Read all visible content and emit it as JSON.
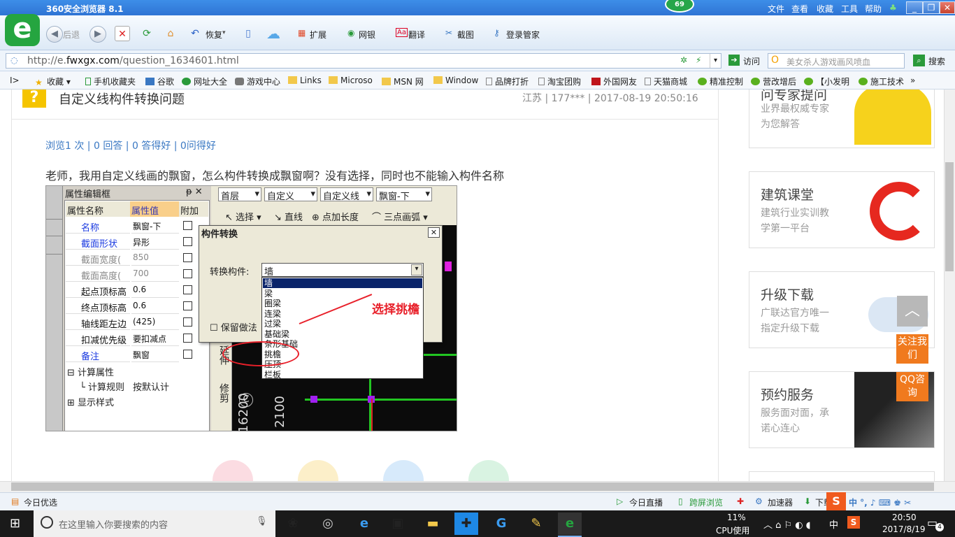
{
  "browser": {
    "title": "360安全浏览器 8.1",
    "badge": "69",
    "menu": [
      "文件",
      "查看",
      "收藏",
      "工具",
      "帮助"
    ],
    "nav": {
      "back": "后退",
      "restore": "恢复"
    },
    "tools": [
      "扩展",
      "网银",
      "翻译",
      "截图",
      "登录管家"
    ],
    "url_prefix": "http://e.",
    "url_host": "fwxgx.com",
    "url_path": "/question_1634601.html",
    "visit": "访问",
    "search_placeholder": "美女杀人游戏画风喷血",
    "search_button": "搜索"
  },
  "bookmarks": [
    "收藏",
    "手机收藏夹",
    "谷歌",
    "网址大全",
    "游戏中心",
    "Links",
    "Microso",
    "MSN 网",
    "Window",
    "品牌打折",
    "淘宝团购",
    "外国网友",
    "天猫商城",
    "精准控制",
    "营改增后",
    "【小发明",
    "施工技术"
  ],
  "question": {
    "title": "自定义线构件转换问题",
    "meta": "江苏 | 177*** | 2017-08-19 20:50:16",
    "stats": "浏览1 次 | 0 回答 | 0 答得好 | 0问得好",
    "body": "老师，我用自定义线画的飘窗，怎么构件转换成飘窗啊？没有选择，同时也不能输入构件名称"
  },
  "screenshot": {
    "panel_title": "属性编辑框",
    "cols": [
      "属性名称",
      "属性值",
      "附加"
    ],
    "rows": [
      {
        "name": "名称",
        "value": "飘窗-下"
      },
      {
        "name": "截面形状",
        "value": "异形"
      },
      {
        "name": "截面宽度(",
        "value": "850"
      },
      {
        "name": "截面高度(",
        "value": "700"
      },
      {
        "name": "起点顶标高",
        "value": "0.6"
      },
      {
        "name": "终点顶标高",
        "value": "0.6"
      },
      {
        "name": "轴线距左边",
        "value": "(425)"
      },
      {
        "name": "扣减优先级",
        "value": "要扣减点"
      },
      {
        "name": "备注",
        "value": "飘窗"
      }
    ],
    "group1": "计算属性",
    "group1_child": "计算规则",
    "group1_child_value": "按默认计",
    "group2": "显示样式",
    "combo": [
      "首层",
      "自定义",
      "自定义线",
      "飘窗-下"
    ],
    "tools": [
      "选择",
      "直线",
      "点加长度",
      "三点画弧"
    ],
    "dialog_title": "构件转换",
    "dialog_label": "转换构件:",
    "dialog_value": "墙",
    "dialog_keep": "保留做法",
    "options": [
      "墙",
      "梁",
      "圈梁",
      "连梁",
      "过梁",
      "基础梁",
      "条形基础",
      "挑檐",
      "压顶",
      "栏板"
    ],
    "annotation": "选择挑檐",
    "vtools": [
      "延伸",
      "修剪"
    ],
    "dims": [
      "16200",
      "2100"
    ]
  },
  "sidebar": [
    {
      "title": "问专家提问",
      "sub": [
        "业界最权威专家",
        "为您解答"
      ]
    },
    {
      "title": "建筑课堂",
      "sub": [
        "建筑行业实训教",
        "学第一平台"
      ]
    },
    {
      "title": "升级下载",
      "sub": [
        "广联达官方唯一",
        "指定升级下载"
      ]
    },
    {
      "title": "预约服务",
      "sub": [
        "服务面对面，承",
        "诺心连心"
      ]
    }
  ],
  "float": {
    "follow": "关注我们",
    "qq": "QQ咨询"
  },
  "status": {
    "left": "今日优选",
    "live": "今日直播",
    "cross": "跨屏浏览",
    "accel": "加速器",
    "download": "下载"
  },
  "taskbar": {
    "search": "在这里输入你要搜索的内容",
    "cpu": "11%",
    "cpu_label": "CPU使用",
    "ime": "中",
    "time": "20:50",
    "date": "2017/8/19",
    "notif": "4"
  },
  "colors": {
    "accent": "#3a78c3",
    "annot": "#e8202a",
    "float": "#f07a1e"
  }
}
